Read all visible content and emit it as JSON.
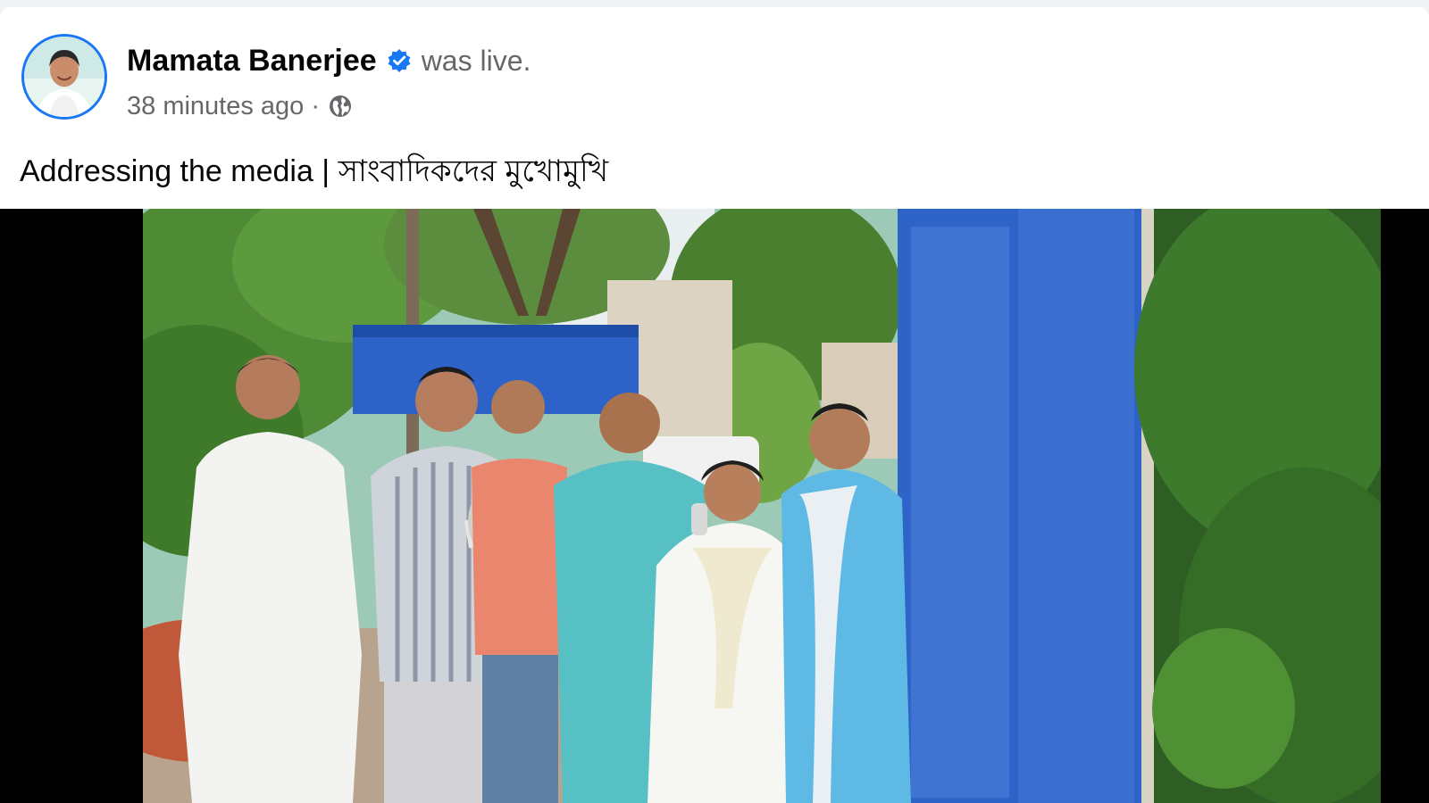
{
  "post": {
    "author": "Mamata Banerjee",
    "verified_icon": "verified-badge-icon",
    "status_text": "was live.",
    "timestamp": "38 minutes ago",
    "separator": "·",
    "privacy_icon": "globe-icon",
    "caption": "Addressing the media | সাংবাদিকদের মুখোমুখি"
  },
  "colors": {
    "accent": "#1877f2",
    "primary_text": "#050505",
    "secondary_text": "#65676b"
  }
}
